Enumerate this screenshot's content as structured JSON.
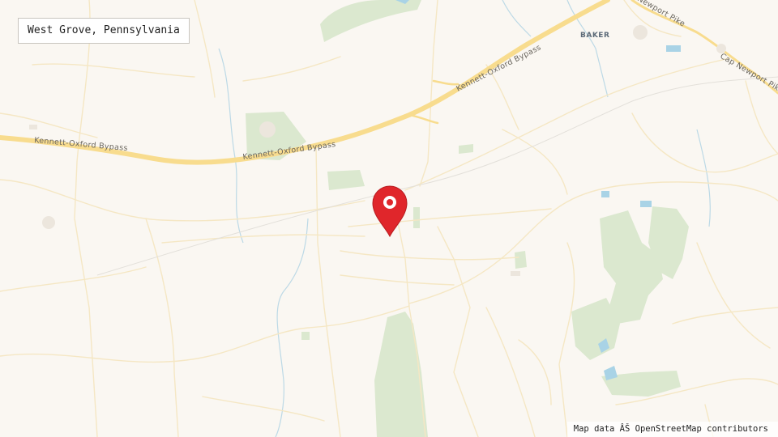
{
  "place_name": "West Grove, Pennsylvania",
  "attribution": "Map data ÂŠ OpenStreetMap contributors",
  "labels": {
    "bypass_1": "Kennett-Oxford Bypass",
    "bypass_2": "Kennett-Oxford Bypass",
    "bypass_3": "Kennett-Oxford Bypass",
    "newport_pike": "Newport Pike",
    "cap_newport_pike": "Cap Newport Pike",
    "baker": "BAKER"
  },
  "marker": {
    "icon": "map-pin-icon",
    "color": "#e0262b"
  },
  "colors": {
    "background": "#faf7f2",
    "highway": "#f8dc8e",
    "minor_road": "#f5e7c4",
    "park": "#dbe8cf",
    "water": "#a9d3e6",
    "stream": "#bcd9e6"
  }
}
